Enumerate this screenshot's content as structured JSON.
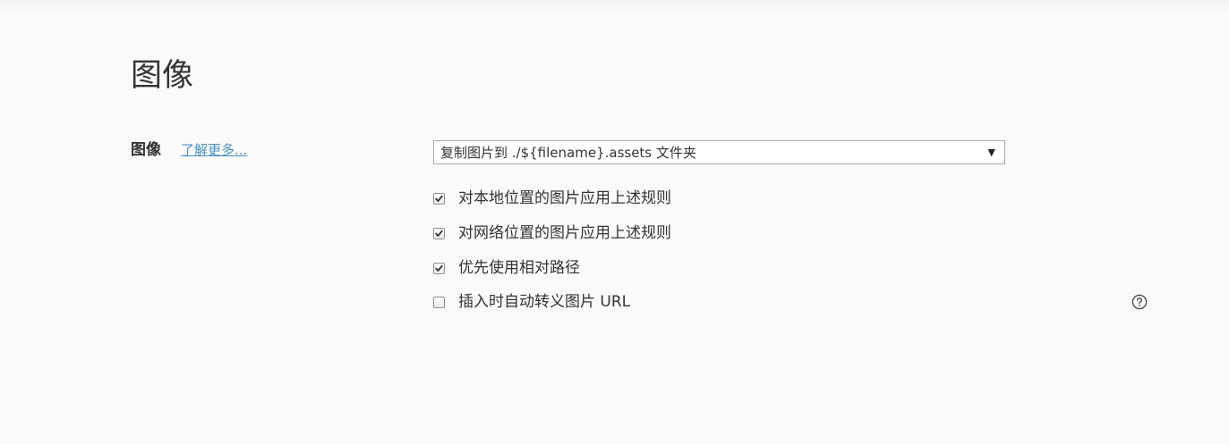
{
  "header": {
    "title": "图像"
  },
  "image_setting": {
    "label": "图像",
    "learn_more": "了解更多...",
    "select": {
      "value": "复制图片到 ./${filename}.assets 文件夹",
      "arrow": "▼"
    },
    "options": [
      {
        "label": "对本地位置的图片应用上述规则",
        "checked": true
      },
      {
        "label": "对网络位置的图片应用上述规则",
        "checked": true
      },
      {
        "label": "优先使用相对路径",
        "checked": true
      },
      {
        "label": "插入时自动转义图片 URL",
        "checked": false
      }
    ],
    "help_icon": "question-circle-icon"
  },
  "colors": {
    "background": "#fafafa",
    "text": "#333333",
    "link": "#4a90c2",
    "border": "#a9a9a9"
  }
}
